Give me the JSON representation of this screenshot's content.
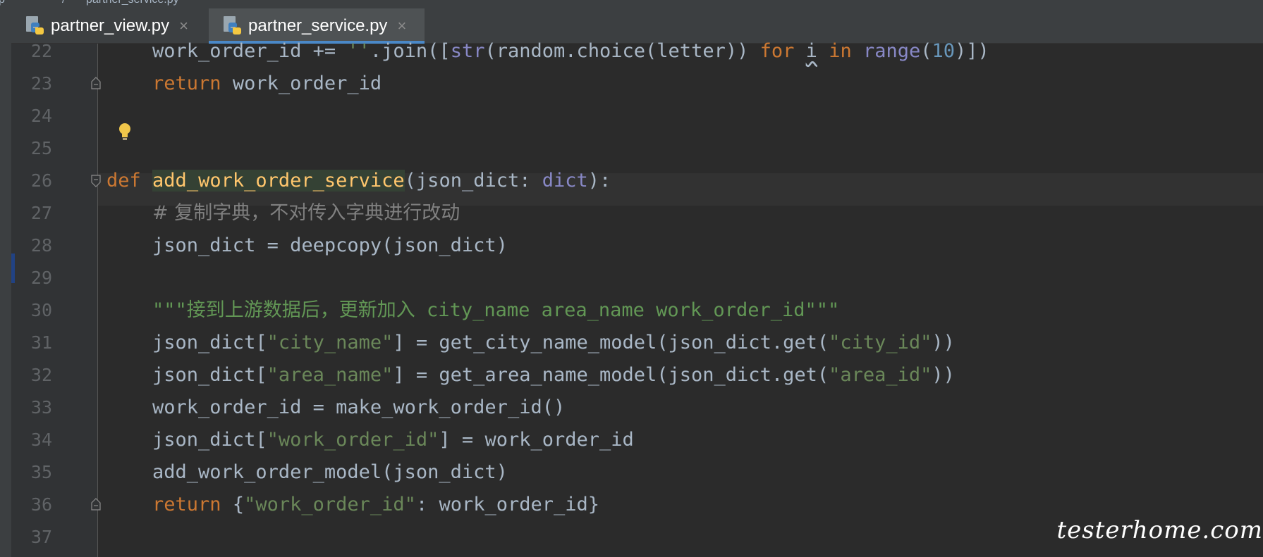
{
  "breadcrumb": {
    "folder": "p",
    "separator": "/",
    "file": "partner_service.py"
  },
  "tabs": [
    {
      "label": "partner_view.py",
      "active": false
    },
    {
      "label": "partner_service.py",
      "active": true
    }
  ],
  "tab_close_glyph": "×",
  "line_numbers": [
    "22",
    "23",
    "24",
    "25",
    "26",
    "27",
    "28",
    "29",
    "30",
    "31",
    "32",
    "33",
    "34",
    "35",
    "36",
    "37"
  ],
  "code": {
    "l22": {
      "a": "    work_order_id += ",
      "b": "''",
      "c": ".join([",
      "d": "str",
      "e": "(random.choice(letter)) ",
      "f": "for",
      "g": " ",
      "h": "i",
      "i": " ",
      "j": "in",
      "k": " ",
      "l": "range",
      "m": "(",
      "n": "10",
      "o": ")])"
    },
    "l23": {
      "a": "    ",
      "b": "return",
      "c": " work_order_id"
    },
    "l26": {
      "a": "def",
      "b": " ",
      "c": "add_work_order_service",
      "d": "(json_dict: ",
      "e": "dict",
      "f": "):"
    },
    "l27": {
      "a": "    ",
      "b": "# 复制字典，不对传入字典进行改动"
    },
    "l28": {
      "a": "    json_dict = deepcopy(json_dict)"
    },
    "l30": {
      "a": "    ",
      "b": "\"\"\"接到上游数据后，更新加入 city_name area_name work_order_id\"\"\""
    },
    "l31": {
      "a": "    json_dict[",
      "b": "\"city_name\"",
      "c": "] = get_city_name_model(json_dict.get(",
      "d": "\"city_id\"",
      "e": "))"
    },
    "l32": {
      "a": "    json_dict[",
      "b": "\"area_name\"",
      "c": "] = get_area_name_model(json_dict.get(",
      "d": "\"area_id\"",
      "e": "))"
    },
    "l33": {
      "a": "    work_order_id = make_work_order_id()"
    },
    "l34": {
      "a": "    json_dict[",
      "b": "\"work_order_id\"",
      "c": "] = work_order_id"
    },
    "l35": {
      "a": "    add_work_order_model(json_dict)"
    },
    "l36": {
      "a": "    ",
      "b": "return",
      "c": " {",
      "d": "\"work_order_id\"",
      "e": ": work_order_id}"
    }
  },
  "watermark": "testerhome.com",
  "colors": {
    "keyword": "#cc7832",
    "string": "#6a8759",
    "number": "#6897bb",
    "builtin": "#8888c6",
    "function": "#ffc66d",
    "comment": "#808080",
    "docstring": "#629755",
    "text": "#a9b7c6",
    "background": "#2b2b2b",
    "tab_accent": "#4a88c7"
  }
}
